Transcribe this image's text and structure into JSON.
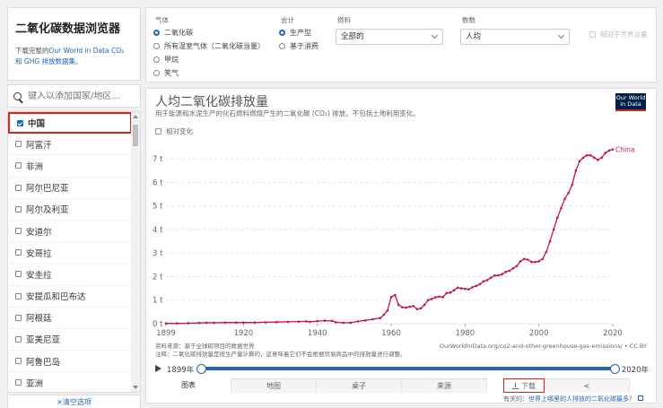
{
  "sidebar": {
    "title": "二氧化碳数据浏览器",
    "sub_prefix": "下载完整的",
    "sub_link1": "Our World in Data CO₂ 和 GHG 排放数据集",
    "sub_suffix": "。",
    "search_placeholder": "键入以添加国家/地区...",
    "countries": [
      "中国",
      "阿富汗",
      "非洲",
      "阿尔巴尼亚",
      "阿尔及利亚",
      "安道尔",
      "安哥拉",
      "安圭拉",
      "安提瓜和巴布达",
      "阿根廷",
      "亚美尼亚",
      "阿鲁巴岛",
      "亚洲"
    ],
    "checked_country": "中国",
    "clear_label": "清空选项",
    "clear_icon": "×"
  },
  "controls": {
    "gas_label": "气体",
    "gas_options": [
      "二氧化碳",
      "所有温室气体（二氧化碳当量）",
      "甲烷",
      "笑气"
    ],
    "count_label": "会计",
    "count_options": [
      "生产型",
      "基于消费"
    ],
    "fuel_label": "燃料",
    "fuel_value": "全部的",
    "metric_label": "数数",
    "metric_value": "人均",
    "relative_world": "相对于世界总量"
  },
  "chart": {
    "title": "人均二氧化碳排放量",
    "subtitle": "用于能源和水泥生产的化石燃料燃烧产生的二氧化碳 (CO₂) 排放。不包括土地利用变化。",
    "logo_line1": "Our World",
    "logo_line2": "in Data",
    "relative_change": "相对变化",
    "source": "资料来源：基于全球碳项目的数据世界",
    "note": "注释：二氧化碳排放量是按生产量计算的，这意味着它们不会根据贸易商品中的排放量进行调整。",
    "url": "OurWorldInData.org/co2-and-other-greenhouse-gas-emissions/ • CC BY",
    "series_label": "China",
    "start_year": "1899年",
    "end_year": "2020年"
  },
  "tabs": {
    "chart": "图表",
    "map": "地图",
    "table": "桌子",
    "sources": "来源",
    "download": "下载"
  },
  "footer": {
    "question": "有关的：",
    "link": "世界上哪里的人排放的二氧化碳最多？"
  },
  "colors": {
    "accent": "#2165b8",
    "series": "#c0135e",
    "highlight": "#e0241c"
  },
  "chart_data": {
    "type": "line",
    "xlabel": "",
    "ylabel": "",
    "xlim": [
      1899,
      2020
    ],
    "ylim": [
      0,
      7.5
    ],
    "x_ticks": [
      1899,
      1920,
      1940,
      1960,
      1980,
      2000,
      2020
    ],
    "y_ticks": [
      "0 t",
      "1 t",
      "2 t",
      "3 t",
      "4 t",
      "5 t",
      "6 t",
      "7 t"
    ],
    "series": [
      {
        "name": "China",
        "points": [
          [
            1899,
            0.01
          ],
          [
            1902,
            0.01
          ],
          [
            1905,
            0.02
          ],
          [
            1908,
            0.03
          ],
          [
            1910,
            0.04
          ],
          [
            1912,
            0.04
          ],
          [
            1915,
            0.05
          ],
          [
            1918,
            0.05
          ],
          [
            1920,
            0.05
          ],
          [
            1923,
            0.05
          ],
          [
            1926,
            0.06
          ],
          [
            1929,
            0.07
          ],
          [
            1932,
            0.08
          ],
          [
            1935,
            0.09
          ],
          [
            1937,
            0.1
          ],
          [
            1938,
            0.08
          ],
          [
            1940,
            0.11
          ],
          [
            1942,
            0.13
          ],
          [
            1944,
            0.12
          ],
          [
            1945,
            0.06
          ],
          [
            1947,
            0.04
          ],
          [
            1949,
            0.04
          ],
          [
            1951,
            0.1
          ],
          [
            1953,
            0.14
          ],
          [
            1955,
            0.19
          ],
          [
            1957,
            0.24
          ],
          [
            1958,
            0.38
          ],
          [
            1959,
            0.56
          ],
          [
            1960,
            1.13
          ],
          [
            1961,
            1.22
          ],
          [
            1962,
            0.8
          ],
          [
            1963,
            0.7
          ],
          [
            1964,
            0.68
          ],
          [
            1965,
            0.72
          ],
          [
            1966,
            0.75
          ],
          [
            1967,
            0.62
          ],
          [
            1968,
            0.65
          ],
          [
            1969,
            0.8
          ],
          [
            1970,
            1.0
          ],
          [
            1971,
            1.05
          ],
          [
            1972,
            1.12
          ],
          [
            1973,
            1.15
          ],
          [
            1974,
            1.13
          ],
          [
            1975,
            1.3
          ],
          [
            1976,
            1.32
          ],
          [
            1977,
            1.42
          ],
          [
            1978,
            1.53
          ],
          [
            1979,
            1.5
          ],
          [
            1980,
            1.48
          ],
          [
            1981,
            1.46
          ],
          [
            1982,
            1.55
          ],
          [
            1983,
            1.6
          ],
          [
            1984,
            1.68
          ],
          [
            1985,
            1.8
          ],
          [
            1986,
            1.85
          ],
          [
            1987,
            1.95
          ],
          [
            1988,
            2.05
          ],
          [
            1989,
            2.05
          ],
          [
            1990,
            2.1
          ],
          [
            1991,
            2.2
          ],
          [
            1992,
            2.25
          ],
          [
            1993,
            2.35
          ],
          [
            1994,
            2.45
          ],
          [
            1995,
            2.65
          ],
          [
            1996,
            2.75
          ],
          [
            1997,
            2.72
          ],
          [
            1998,
            2.62
          ],
          [
            1999,
            2.62
          ],
          [
            2000,
            2.65
          ],
          [
            2001,
            2.75
          ],
          [
            2002,
            3.05
          ],
          [
            2003,
            3.5
          ],
          [
            2004,
            4.0
          ],
          [
            2005,
            4.5
          ],
          [
            2006,
            4.9
          ],
          [
            2007,
            5.3
          ],
          [
            2008,
            5.55
          ],
          [
            2009,
            5.9
          ],
          [
            2010,
            6.5
          ],
          [
            2011,
            6.9
          ],
          [
            2012,
            7.05
          ],
          [
            2013,
            7.15
          ],
          [
            2014,
            7.15
          ],
          [
            2015,
            7.05
          ],
          [
            2016,
            6.95
          ],
          [
            2017,
            7.05
          ],
          [
            2018,
            7.25
          ],
          [
            2019,
            7.35
          ],
          [
            2020,
            7.4
          ]
        ]
      }
    ]
  }
}
